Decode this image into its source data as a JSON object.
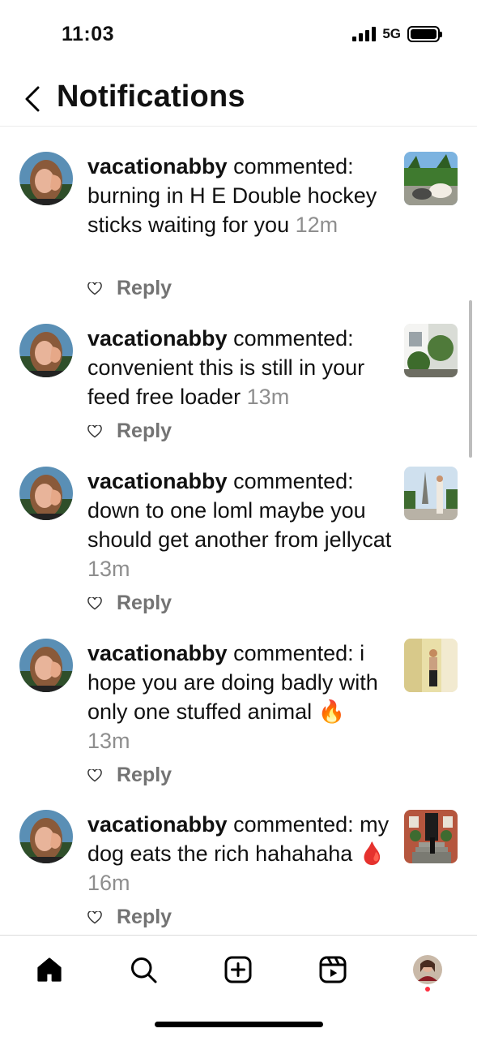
{
  "status_bar": {
    "time": "11:03",
    "network": "5G",
    "signal_bars": 4
  },
  "header": {
    "title": "Notifications",
    "back_icon": "chevron-left-icon"
  },
  "notifications": [
    {
      "username": "vacationabby",
      "text": "commented: burning in H E Double hockey sticks waiting for you",
      "time": "12m",
      "reply_label": "Reply",
      "thumb": "puppy-photo"
    },
    {
      "username": "vacationabby",
      "text": "commented: convenient this is still in your feed free loader",
      "time": "13m",
      "reply_label": "Reply",
      "thumb": "garden-photo"
    },
    {
      "username": "vacationabby",
      "text": "commented: down to one loml maybe you should get another from jellycat",
      "time": "13m",
      "reply_label": "Reply",
      "thumb": "paris-photo"
    },
    {
      "username": "vacationabby",
      "text": "commented: i hope you are doing badly with only one stuffed animal 🔥",
      "time": "13m",
      "reply_label": "Reply",
      "thumb": "mirror-photo"
    },
    {
      "username": "vacationabby",
      "text": "commented: my dog eats the rich hahahaha 🩸",
      "time": "16m",
      "reply_label": "Reply",
      "thumb": "stoop-photo"
    }
  ],
  "tab_bar": {
    "items": [
      "home-icon",
      "search-icon",
      "create-icon",
      "reels-icon",
      "profile-avatar"
    ]
  },
  "colors": {
    "time_gray": "#8e8e8e",
    "reply_gray": "#737373",
    "notification_dot": "#ff3040"
  }
}
